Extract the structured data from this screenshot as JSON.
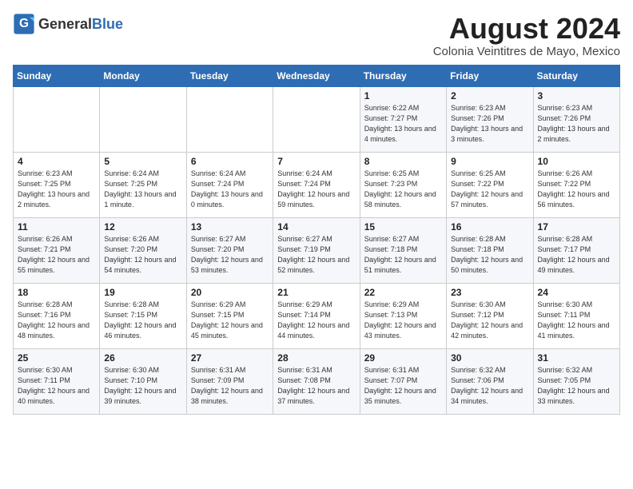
{
  "header": {
    "logo_general": "General",
    "logo_blue": "Blue",
    "month_title": "August 2024",
    "location": "Colonia Veintitres de Mayo, Mexico"
  },
  "weekdays": [
    "Sunday",
    "Monday",
    "Tuesday",
    "Wednesday",
    "Thursday",
    "Friday",
    "Saturday"
  ],
  "weeks": [
    [
      {
        "day": "",
        "sunrise": "",
        "sunset": "",
        "daylight": ""
      },
      {
        "day": "",
        "sunrise": "",
        "sunset": "",
        "daylight": ""
      },
      {
        "day": "",
        "sunrise": "",
        "sunset": "",
        "daylight": ""
      },
      {
        "day": "",
        "sunrise": "",
        "sunset": "",
        "daylight": ""
      },
      {
        "day": "1",
        "sunrise": "Sunrise: 6:22 AM",
        "sunset": "Sunset: 7:27 PM",
        "daylight": "Daylight: 13 hours and 4 minutes."
      },
      {
        "day": "2",
        "sunrise": "Sunrise: 6:23 AM",
        "sunset": "Sunset: 7:26 PM",
        "daylight": "Daylight: 13 hours and 3 minutes."
      },
      {
        "day": "3",
        "sunrise": "Sunrise: 6:23 AM",
        "sunset": "Sunset: 7:26 PM",
        "daylight": "Daylight: 13 hours and 2 minutes."
      }
    ],
    [
      {
        "day": "4",
        "sunrise": "Sunrise: 6:23 AM",
        "sunset": "Sunset: 7:25 PM",
        "daylight": "Daylight: 13 hours and 2 minutes."
      },
      {
        "day": "5",
        "sunrise": "Sunrise: 6:24 AM",
        "sunset": "Sunset: 7:25 PM",
        "daylight": "Daylight: 13 hours and 1 minute."
      },
      {
        "day": "6",
        "sunrise": "Sunrise: 6:24 AM",
        "sunset": "Sunset: 7:24 PM",
        "daylight": "Daylight: 13 hours and 0 minutes."
      },
      {
        "day": "7",
        "sunrise": "Sunrise: 6:24 AM",
        "sunset": "Sunset: 7:24 PM",
        "daylight": "Daylight: 12 hours and 59 minutes."
      },
      {
        "day": "8",
        "sunrise": "Sunrise: 6:25 AM",
        "sunset": "Sunset: 7:23 PM",
        "daylight": "Daylight: 12 hours and 58 minutes."
      },
      {
        "day": "9",
        "sunrise": "Sunrise: 6:25 AM",
        "sunset": "Sunset: 7:22 PM",
        "daylight": "Daylight: 12 hours and 57 minutes."
      },
      {
        "day": "10",
        "sunrise": "Sunrise: 6:26 AM",
        "sunset": "Sunset: 7:22 PM",
        "daylight": "Daylight: 12 hours and 56 minutes."
      }
    ],
    [
      {
        "day": "11",
        "sunrise": "Sunrise: 6:26 AM",
        "sunset": "Sunset: 7:21 PM",
        "daylight": "Daylight: 12 hours and 55 minutes."
      },
      {
        "day": "12",
        "sunrise": "Sunrise: 6:26 AM",
        "sunset": "Sunset: 7:20 PM",
        "daylight": "Daylight: 12 hours and 54 minutes."
      },
      {
        "day": "13",
        "sunrise": "Sunrise: 6:27 AM",
        "sunset": "Sunset: 7:20 PM",
        "daylight": "Daylight: 12 hours and 53 minutes."
      },
      {
        "day": "14",
        "sunrise": "Sunrise: 6:27 AM",
        "sunset": "Sunset: 7:19 PM",
        "daylight": "Daylight: 12 hours and 52 minutes."
      },
      {
        "day": "15",
        "sunrise": "Sunrise: 6:27 AM",
        "sunset": "Sunset: 7:18 PM",
        "daylight": "Daylight: 12 hours and 51 minutes."
      },
      {
        "day": "16",
        "sunrise": "Sunrise: 6:28 AM",
        "sunset": "Sunset: 7:18 PM",
        "daylight": "Daylight: 12 hours and 50 minutes."
      },
      {
        "day": "17",
        "sunrise": "Sunrise: 6:28 AM",
        "sunset": "Sunset: 7:17 PM",
        "daylight": "Daylight: 12 hours and 49 minutes."
      }
    ],
    [
      {
        "day": "18",
        "sunrise": "Sunrise: 6:28 AM",
        "sunset": "Sunset: 7:16 PM",
        "daylight": "Daylight: 12 hours and 48 minutes."
      },
      {
        "day": "19",
        "sunrise": "Sunrise: 6:28 AM",
        "sunset": "Sunset: 7:15 PM",
        "daylight": "Daylight: 12 hours and 46 minutes."
      },
      {
        "day": "20",
        "sunrise": "Sunrise: 6:29 AM",
        "sunset": "Sunset: 7:15 PM",
        "daylight": "Daylight: 12 hours and 45 minutes."
      },
      {
        "day": "21",
        "sunrise": "Sunrise: 6:29 AM",
        "sunset": "Sunset: 7:14 PM",
        "daylight": "Daylight: 12 hours and 44 minutes."
      },
      {
        "day": "22",
        "sunrise": "Sunrise: 6:29 AM",
        "sunset": "Sunset: 7:13 PM",
        "daylight": "Daylight: 12 hours and 43 minutes."
      },
      {
        "day": "23",
        "sunrise": "Sunrise: 6:30 AM",
        "sunset": "Sunset: 7:12 PM",
        "daylight": "Daylight: 12 hours and 42 minutes."
      },
      {
        "day": "24",
        "sunrise": "Sunrise: 6:30 AM",
        "sunset": "Sunset: 7:11 PM",
        "daylight": "Daylight: 12 hours and 41 minutes."
      }
    ],
    [
      {
        "day": "25",
        "sunrise": "Sunrise: 6:30 AM",
        "sunset": "Sunset: 7:11 PM",
        "daylight": "Daylight: 12 hours and 40 minutes."
      },
      {
        "day": "26",
        "sunrise": "Sunrise: 6:30 AM",
        "sunset": "Sunset: 7:10 PM",
        "daylight": "Daylight: 12 hours and 39 minutes."
      },
      {
        "day": "27",
        "sunrise": "Sunrise: 6:31 AM",
        "sunset": "Sunset: 7:09 PM",
        "daylight": "Daylight: 12 hours and 38 minutes."
      },
      {
        "day": "28",
        "sunrise": "Sunrise: 6:31 AM",
        "sunset": "Sunset: 7:08 PM",
        "daylight": "Daylight: 12 hours and 37 minutes."
      },
      {
        "day": "29",
        "sunrise": "Sunrise: 6:31 AM",
        "sunset": "Sunset: 7:07 PM",
        "daylight": "Daylight: 12 hours and 35 minutes."
      },
      {
        "day": "30",
        "sunrise": "Sunrise: 6:32 AM",
        "sunset": "Sunset: 7:06 PM",
        "daylight": "Daylight: 12 hours and 34 minutes."
      },
      {
        "day": "31",
        "sunrise": "Sunrise: 6:32 AM",
        "sunset": "Sunset: 7:05 PM",
        "daylight": "Daylight: 12 hours and 33 minutes."
      }
    ]
  ]
}
